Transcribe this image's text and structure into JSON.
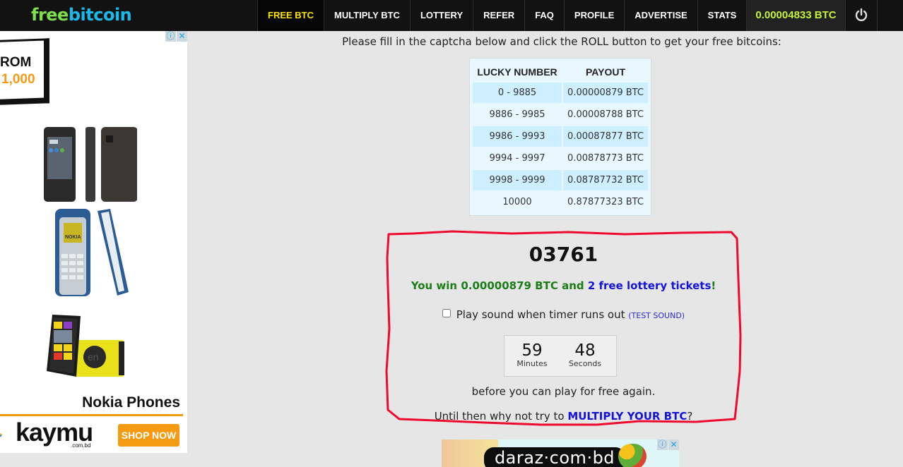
{
  "header": {
    "logo_part1": "free",
    "logo_part2": "bitcoin",
    "nav": [
      {
        "label": "FREE BTC",
        "active": true
      },
      {
        "label": "MULTIPLY BTC"
      },
      {
        "label": "LOTTERY"
      },
      {
        "label": "REFER"
      },
      {
        "label": "FAQ"
      },
      {
        "label": "PROFILE"
      },
      {
        "label": "ADVERTISE"
      },
      {
        "label": "STATS"
      }
    ],
    "balance": "0.00004833 BTC",
    "logout_icon": "power-icon"
  },
  "left_ad": {
    "info_icon": "ⓘ",
    "close_icon": "✕",
    "text_rom": "ROM",
    "price": "1,000",
    "headline": "Nokia Phones",
    "brand": "kaymu",
    "brand_sub": ".com.bd",
    "cta": "SHOP NOW"
  },
  "main": {
    "intro": "Please fill in the captcha below and click the ROLL button to get your free bitcoins:",
    "payout_table": {
      "headers": [
        "LUCKY NUMBER",
        "PAYOUT"
      ],
      "rows": [
        [
          "0 - 9885",
          "0.00000879 BTC"
        ],
        [
          "9886 - 9985",
          "0.00008788 BTC"
        ],
        [
          "9986 - 9993",
          "0.00087877 BTC"
        ],
        [
          "9994 - 9997",
          "0.00878773 BTC"
        ],
        [
          "9998 - 9999",
          "0.08787732 BTC"
        ],
        [
          "10000",
          "0.87877323 BTC"
        ]
      ]
    },
    "result": {
      "roll_number": "03761",
      "win_prefix": "You win 0.00000879 BTC and ",
      "win_tickets": "2 free lottery tickets",
      "win_suffix": "!",
      "sound_label": "Play sound when timer runs out ",
      "sound_checked": false,
      "test_sound": "(TEST SOUND)",
      "timer": {
        "minutes": "59",
        "minutes_label": "Minutes",
        "seconds": "48",
        "seconds_label": "Seconds"
      },
      "again_text": "before you can play for free again.",
      "until_prefix": "Until then why not try to ",
      "until_link": "MULTIPLY YOUR BTC",
      "until_suffix": "?"
    }
  },
  "bottom_ad": {
    "brand": "daraz·com·bd",
    "info_icon": "ⓘ",
    "close_icon": "✕"
  },
  "colors": {
    "nav_bg": "#121212",
    "active_nav": "#ffe600",
    "balance": "#c7f23a",
    "win_green": "#1c7d18",
    "link_blue": "#1414d8",
    "annotation_red": "#ee0a2e"
  }
}
